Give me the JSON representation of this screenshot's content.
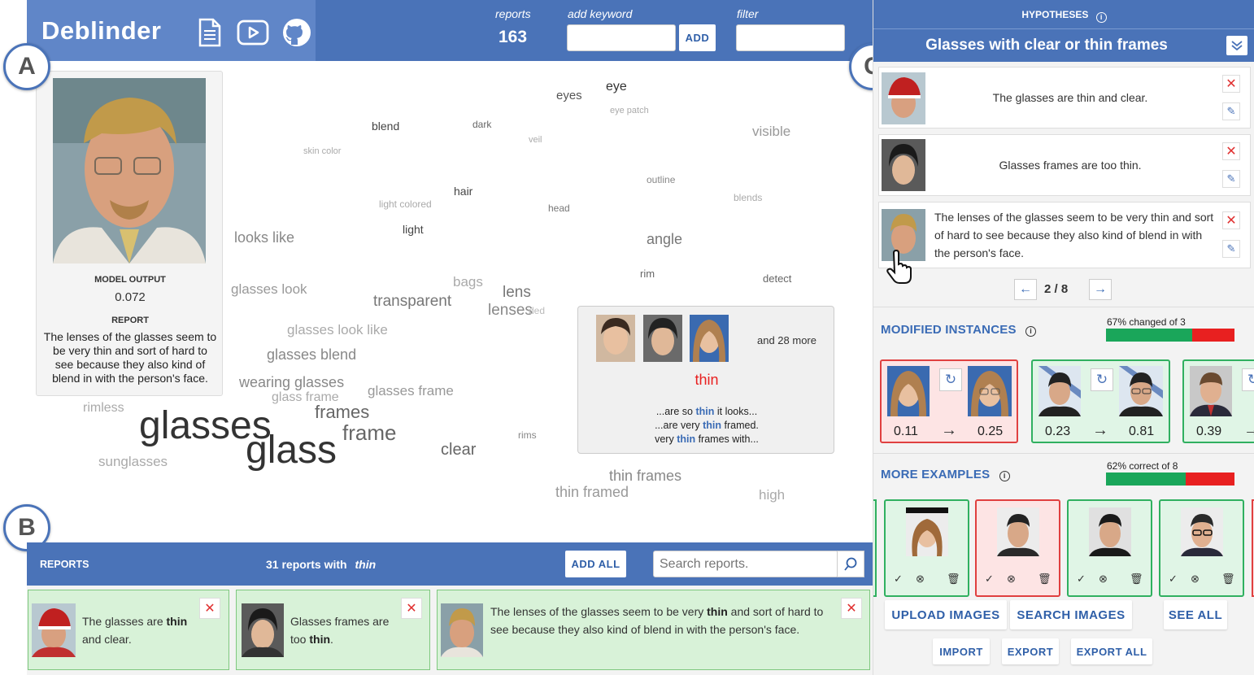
{
  "header": {
    "title": "Deblinder",
    "icons": [
      "document-icon",
      "video-icon",
      "github-icon"
    ],
    "reports_label": "reports",
    "reports_count": "163",
    "add_keyword_label": "add keyword",
    "add_button": "ADD",
    "filter_label": "filter"
  },
  "badges": {
    "a": "A",
    "b": "B",
    "c": "C"
  },
  "instance": {
    "model_output_label": "MODEL OUTPUT",
    "model_output_value": "0.072",
    "report_label": "REPORT",
    "report_text": "The lenses of the glasses seem to be very thin and sort of hard to see because they also kind of blend in with the person's face."
  },
  "wordcloud": [
    {
      "t": "eyes",
      "s": 15,
      "c": "#555"
    },
    {
      "t": "eye",
      "s": 16,
      "c": "#333"
    },
    {
      "t": "eye patch",
      "s": 11,
      "c": "#aaa"
    },
    {
      "t": "blend",
      "s": 14,
      "c": "#444"
    },
    {
      "t": "dark",
      "s": 12,
      "c": "#666"
    },
    {
      "t": "veil",
      "s": 11,
      "c": "#aaa"
    },
    {
      "t": "visible",
      "s": 17,
      "c": "#999"
    },
    {
      "t": "skin color",
      "s": 11,
      "c": "#aaa"
    },
    {
      "t": "outline",
      "s": 12,
      "c": "#888"
    },
    {
      "t": "hair",
      "s": 14,
      "c": "#444"
    },
    {
      "t": "light colored",
      "s": 12,
      "c": "#aaa"
    },
    {
      "t": "head",
      "s": 12,
      "c": "#777"
    },
    {
      "t": "blends",
      "s": 12,
      "c": "#aaa"
    },
    {
      "t": "light",
      "s": 14,
      "c": "#444"
    },
    {
      "t": "looks like",
      "s": 18,
      "c": "#888"
    },
    {
      "t": "angle",
      "s": 18,
      "c": "#777"
    },
    {
      "t": "rim",
      "s": 13,
      "c": "#666"
    },
    {
      "t": "detect",
      "s": 13,
      "c": "#666"
    },
    {
      "t": "glasses look",
      "s": 17,
      "c": "#999"
    },
    {
      "t": "bags",
      "s": 17,
      "c": "#aaa"
    },
    {
      "t": "lens",
      "s": 19,
      "c": "#777"
    },
    {
      "t": "transparent",
      "s": 19,
      "c": "#777"
    },
    {
      "t": "lenses",
      "s": 19,
      "c": "#888"
    },
    {
      "t": "ded",
      "s": 12,
      "c": "#bbb"
    },
    {
      "t": "glasses look like",
      "s": 17,
      "c": "#aaa"
    },
    {
      "t": "glasses blend",
      "s": 18,
      "c": "#888"
    },
    {
      "t": "wearing glasses",
      "s": 18,
      "c": "#888"
    },
    {
      "t": "glasses frame",
      "s": 17,
      "c": "#999"
    },
    {
      "t": "glass frame",
      "s": 16,
      "c": "#aaa"
    },
    {
      "t": "rimless",
      "s": 16,
      "c": "#aaa"
    },
    {
      "t": "frames",
      "s": 22,
      "c": "#666"
    },
    {
      "t": "glasses",
      "s": 48,
      "c": "#333"
    },
    {
      "t": "frame",
      "s": 26,
      "c": "#666"
    },
    {
      "t": "glass",
      "s": 48,
      "c": "#333"
    },
    {
      "t": "clear",
      "s": 20,
      "c": "#666"
    },
    {
      "t": "rims",
      "s": 12,
      "c": "#888"
    },
    {
      "t": "sunglasses",
      "s": 17,
      "c": "#aaa"
    },
    {
      "t": "thin frames",
      "s": 18,
      "c": "#888"
    },
    {
      "t": "thin framed",
      "s": 18,
      "c": "#999"
    },
    {
      "t": "high",
      "s": 17,
      "c": "#aaa"
    }
  ],
  "tooltip": {
    "more": "and 28 more",
    "keyword": "thin",
    "contexts": [
      {
        "pre": "...are so ",
        "kw": "thin",
        "post": " it looks..."
      },
      {
        "pre": "...are very ",
        "kw": "thin",
        "post": " framed."
      },
      {
        "pre": "very ",
        "kw": "thin",
        "post": " frames with..."
      }
    ]
  },
  "reports_bar": {
    "label": "REPORTS",
    "count_text": "31 reports with",
    "keyword": "thin",
    "add_all": "ADD ALL",
    "search_placeholder": "Search reports."
  },
  "report_cards": [
    {
      "pre": "The glasses are ",
      "kw": "thin",
      "post": " and clear."
    },
    {
      "pre": "Glasses frames are too ",
      "kw": "thin",
      "post": "."
    },
    {
      "pre": "The lenses of the glasses seem to be very ",
      "kw": "thin",
      "post": " and sort of hard to see because they also kind of blend in with the person's face."
    }
  ],
  "sidebar": {
    "hypotheses_label": "HYPOTHESES",
    "hypothesis_title": "Glasses with clear or thin frames",
    "hyp_reports": [
      "The glasses are thin and clear.",
      "Glasses frames are too thin.",
      "The lenses of the glasses seem to be very thin and sort of hard to see because they also kind of blend in with the person's face."
    ],
    "pager": "2 / 8",
    "modified_label": "MODIFIED INSTANCES",
    "modified_stat": "67% changed of 3",
    "modified_pct": 0.67,
    "modified": [
      {
        "from": "0.11",
        "to": "0.25"
      },
      {
        "from": "0.23",
        "to": "0.81"
      },
      {
        "from": "0.39",
        "to": ""
      }
    ],
    "more_label": "MORE EXAMPLES",
    "more_stat": "62% correct of 8",
    "more_pct": 0.62,
    "upload": "UPLOAD IMAGES",
    "search": "SEARCH IMAGES",
    "see_all": "SEE ALL",
    "import": "IMPORT",
    "export": "EXPORT",
    "export_all": "EXPORT ALL"
  },
  "colors": {
    "primary": "#4a73b8",
    "green": "#1aa65a",
    "red": "#e82020",
    "keyword_blue": "#3a6bb5"
  }
}
